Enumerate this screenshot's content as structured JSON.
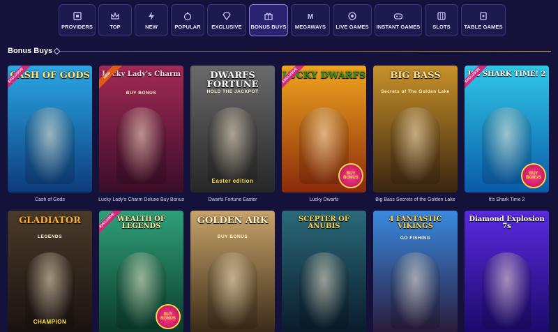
{
  "nav": {
    "items": [
      {
        "label": "PROVIDERS",
        "icon": "providers-icon"
      },
      {
        "label": "TOP",
        "icon": "crown-icon"
      },
      {
        "label": "NEW",
        "icon": "new-icon"
      },
      {
        "label": "POPULAR",
        "icon": "popular-icon"
      },
      {
        "label": "EXCLUSIVE",
        "icon": "diamond-icon"
      },
      {
        "label": "BONUS BUYS",
        "icon": "bonus-buys-icon"
      },
      {
        "label": "MEGAWAYS",
        "icon": "megaways-icon"
      },
      {
        "label": "LIVE GAMES",
        "icon": "live-games-icon"
      },
      {
        "label": "INSTANT GAMES",
        "icon": "instant-games-icon"
      },
      {
        "label": "SLOTS",
        "icon": "slots-icon"
      },
      {
        "label": "TABLE GAMES",
        "icon": "table-games-icon"
      }
    ],
    "active": "BONUS BUYS"
  },
  "section": {
    "title": "Bonus Buys"
  },
  "games": [
    {
      "name": "Cash of Gods",
      "art_title": "CASH OF GODS",
      "tag": "EXCLUSIVE",
      "bg": [
        "#2aa8e6",
        "#0d3b7a"
      ],
      "title_color": "#ffe27a"
    },
    {
      "name": "Lucky Lady's Charm Deluxe Buy Bonus",
      "art_title": "Lucky Lady's Charm",
      "art_sub": "BUY BONUS",
      "tag": "NEW",
      "bg": [
        "#a32a56",
        "#3a0d26"
      ],
      "title_color": "#ffd9e6"
    },
    {
      "name": "Dwarfs Fortune Easter",
      "art_title": "DWARFS FORTUNE",
      "art_sub": "HOLD THE JACKPOT",
      "extra": "Easter edition",
      "bg": [
        "#6a6a6a",
        "#262626"
      ],
      "title_color": "#ffffff"
    },
    {
      "name": "Lucky Dwarfs",
      "art_title": "LUCKY DWARFS",
      "tag": "EXCLUSIVE",
      "badge": "BUY BONUS",
      "bg": [
        "#f0a51e",
        "#8a2a0a"
      ],
      "title_color": "#2a8a2a"
    },
    {
      "name": "Big Bass Secrets of the Golden Lake",
      "art_title": "BIG BASS",
      "art_sub": "Secrets of The Golden Lake",
      "bg": [
        "#c8922a",
        "#3a2410"
      ],
      "title_color": "#ffe9a0"
    },
    {
      "name": "It's Shark Time 2",
      "art_title": "It's SHARK TIME! 2",
      "tag": "EXCLUSIVE",
      "badge": "BUY BONUS",
      "bg": [
        "#2fc8e8",
        "#0a5aa8"
      ],
      "title_color": "#ffffff"
    },
    {
      "name": "Gladiator Legends",
      "art_title": "GLADIATOR",
      "art_sub": "LEGENDS",
      "extra": "CHAMPION",
      "bg": [
        "#4a3a2a",
        "#181210"
      ],
      "title_color": "#ffb02a"
    },
    {
      "name": "Wealth of Legends",
      "art_title": "WEALTH OF LEGENDS",
      "tag": "EXCLUSIVE",
      "badge": "BUY BONUS",
      "bg": [
        "#2fa07a",
        "#0a3a2a"
      ],
      "title_color": "#ffe9a0"
    },
    {
      "name": "Golden Ark Buy Bonus",
      "art_title": "GOLDEN ARK",
      "art_sub": "BUY BONUS",
      "bg": [
        "#c8a46a",
        "#3a2a18"
      ],
      "title_color": "#fff2c8"
    },
    {
      "name": "Scepter of Anubis",
      "art_title": "SCEPTER OF ANUBIS",
      "bg": [
        "#2a6a7a",
        "#0a1a2a"
      ],
      "title_color": "#ffd24a"
    },
    {
      "name": "4 Fantastic Vikings Go Fishing",
      "art_title": "4 FANTASTIC VIKINGS",
      "art_sub": "GO FISHING",
      "bg": [
        "#3a8ae0",
        "#2a1a3a"
      ],
      "title_color": "#ffd24a"
    },
    {
      "name": "Diamond Explosion 7s",
      "art_title": "Diamond Explosion 7s",
      "bg": [
        "#5a2ae0",
        "#1a0a6a"
      ],
      "title_color": "#ffffff"
    }
  ],
  "colors": {
    "background": "#14123a",
    "nav_bg": "#1d1a4e",
    "accent": "#8b7cf0"
  }
}
